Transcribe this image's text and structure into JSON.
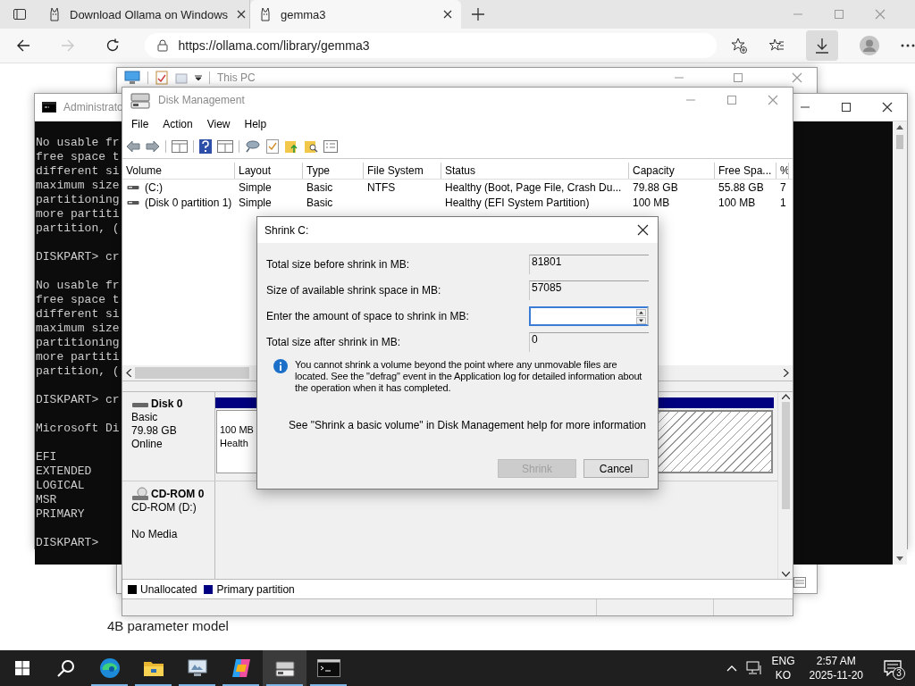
{
  "browser": {
    "tabs": [
      {
        "title": "Download Ollama on Windows",
        "selected": false
      },
      {
        "title": "gemma3",
        "selected": true
      }
    ],
    "forward_disabled": true,
    "address": "https://ollama.com/library/gemma3",
    "download_highlighted": true,
    "page_text": "4B parameter model"
  },
  "this_pc_window": {
    "title": "This PC"
  },
  "console_window": {
    "title": "Administrato",
    "blocks": [
      [
        "No usable fr",
        "free space t",
        "different si",
        "maximum size",
        "partitioning",
        "more partiti",
        "partition, ("
      ],
      [
        "DISKPART> cr"
      ],
      [
        "No usable fr",
        "free space t",
        "different si",
        "maximum size",
        "partitioning",
        "more partiti",
        "partition, ("
      ],
      [
        "DISKPART> cr"
      ],
      [
        "Microsoft Di"
      ],
      [
        "EFI",
        "EXTENDED",
        "LOGICAL",
        "MSR",
        "PRIMARY"
      ],
      [
        "DISKPART>"
      ]
    ]
  },
  "disk_management": {
    "title": "Disk Management",
    "menu": [
      "File",
      "Action",
      "View",
      "Help"
    ],
    "volume_list": {
      "columns": [
        "Volume",
        "Layout",
        "Type",
        "File System",
        "Status",
        "Capacity",
        "Free Spa...",
        "%"
      ],
      "rows": [
        [
          "(C:)",
          "Simple",
          "Basic",
          "NTFS",
          "Healthy (Boot, Page File, Crash Du...",
          "79.88 GB",
          "55.88 GB",
          "7"
        ],
        [
          "(Disk 0 partition 1)",
          "Simple",
          "Basic",
          "",
          "Healthy (EFI System Partition)",
          "100 MB",
          "100 MB",
          "1"
        ]
      ]
    },
    "disks": [
      {
        "kind": "disk",
        "name": "Disk 0",
        "lines": [
          "Basic",
          "79.98 GB",
          "Online"
        ],
        "partitions": [
          {
            "size": "100 MB",
            "status": "Health",
            "selected": false
          },
          {
            "selected": true
          }
        ]
      },
      {
        "kind": "cdrom",
        "name": "CD-ROM 0",
        "lines": [
          "CD-ROM (D:)"
        ],
        "note": "No Media"
      }
    ],
    "legend": [
      {
        "label": "Unallocated",
        "color": "#000000"
      },
      {
        "label": "Primary partition",
        "color": "#000080"
      }
    ]
  },
  "dialog": {
    "title": "Shrink C:",
    "fields": [
      {
        "label": "Total size before shrink in MB:",
        "kind": "readonly",
        "value": "81801",
        "focused": false
      },
      {
        "label": "Size of available shrink space in MB:",
        "kind": "readonly",
        "value": "57085",
        "focused": false
      },
      {
        "label": "Enter the amount of space to shrink in MB:",
        "kind": "spin",
        "focused": true
      },
      {
        "label": "Total size after shrink in MB:",
        "kind": "readonly",
        "value": "0",
        "focused": false
      }
    ],
    "info": "You cannot shrink a volume beyond the point where any unmovable files are located. See the \"defrag\" event in the Application log for detailed information about the operation when it has completed.",
    "help": "See \"Shrink a basic volume\" in Disk Management help for more information",
    "buttons": [
      {
        "label": "Shrink",
        "disabled": true
      },
      {
        "label": "Cancel",
        "disabled": false
      }
    ]
  },
  "taskbar": {
    "apps": [
      {
        "kind": "browser",
        "running": true,
        "selected": false
      },
      {
        "kind": "folder",
        "running": true,
        "selected": false
      },
      {
        "kind": "monitor",
        "running": true,
        "selected": false
      },
      {
        "kind": "copilot",
        "running": true,
        "selected": false
      },
      {
        "kind": "disk",
        "running": true,
        "selected": true
      },
      {
        "kind": "console",
        "running": true,
        "selected": false
      }
    ],
    "language": "ENG",
    "layout": "KO",
    "time": "2:57 AM",
    "date": "2025-11-20",
    "notifications": "3"
  }
}
